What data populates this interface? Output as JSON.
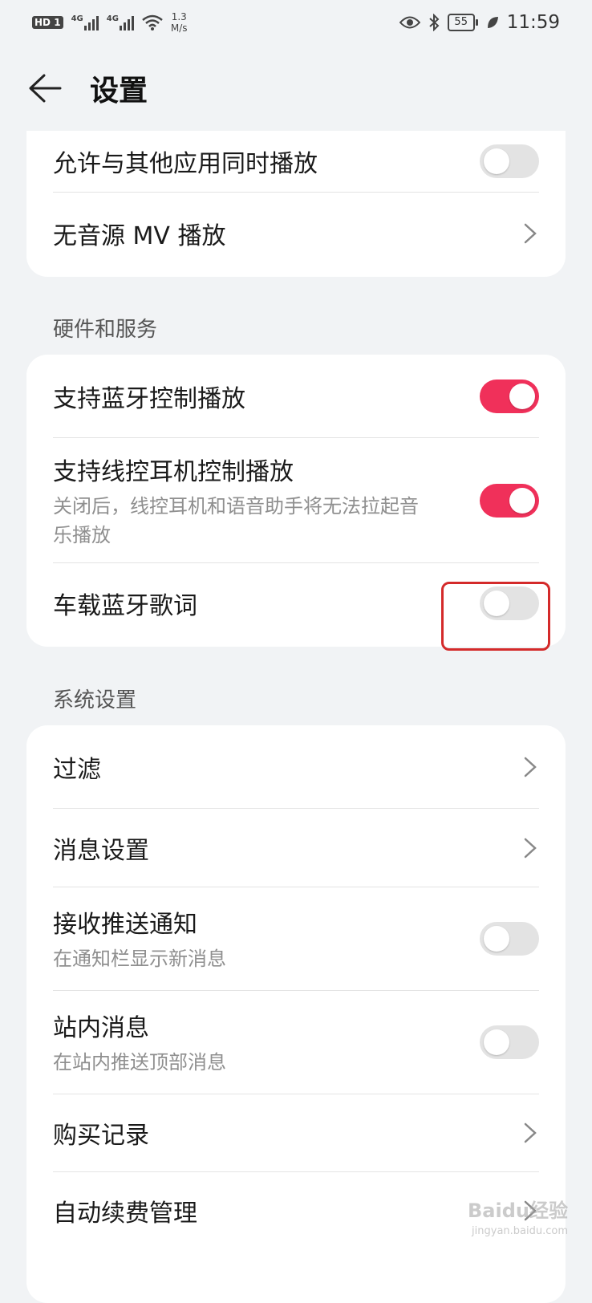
{
  "status_bar": {
    "hd_label": "HD",
    "sim1": "1",
    "net1": "4G",
    "net2": "4G",
    "speed_value": "1.3",
    "speed_unit": "M/s",
    "battery": "55",
    "time": "11:59"
  },
  "header": {
    "title": "设置"
  },
  "playback": {
    "items": [
      {
        "label": "允许与其他应用同时播放",
        "toggle": false
      },
      {
        "label": "无音源 MV 播放"
      }
    ]
  },
  "hardware": {
    "section_title": "硬件和服务",
    "items": [
      {
        "label": "支持蓝牙控制播放",
        "toggle": true
      },
      {
        "label": "支持线控耳机控制播放",
        "subtitle": "关闭后，线控耳机和语音助手将无法拉起音乐播放",
        "toggle": true
      },
      {
        "label": "车载蓝牙歌词",
        "toggle": false
      }
    ]
  },
  "system": {
    "section_title": "系统设置",
    "items": [
      {
        "label": "过滤"
      },
      {
        "label": "消息设置"
      },
      {
        "label": "接收推送通知",
        "subtitle": "在通知栏显示新消息",
        "toggle": false
      },
      {
        "label": "站内消息",
        "subtitle": "在站内推送顶部消息",
        "toggle": false
      },
      {
        "label": "购买记录"
      },
      {
        "label": "自动续费管理"
      }
    ]
  },
  "watermark": {
    "text": "Baidu经验",
    "url": "jingyan.baidu.com"
  },
  "colors": {
    "accent": "#f0305a",
    "highlight": "#d42a2a",
    "background": "#f1f3f5"
  }
}
